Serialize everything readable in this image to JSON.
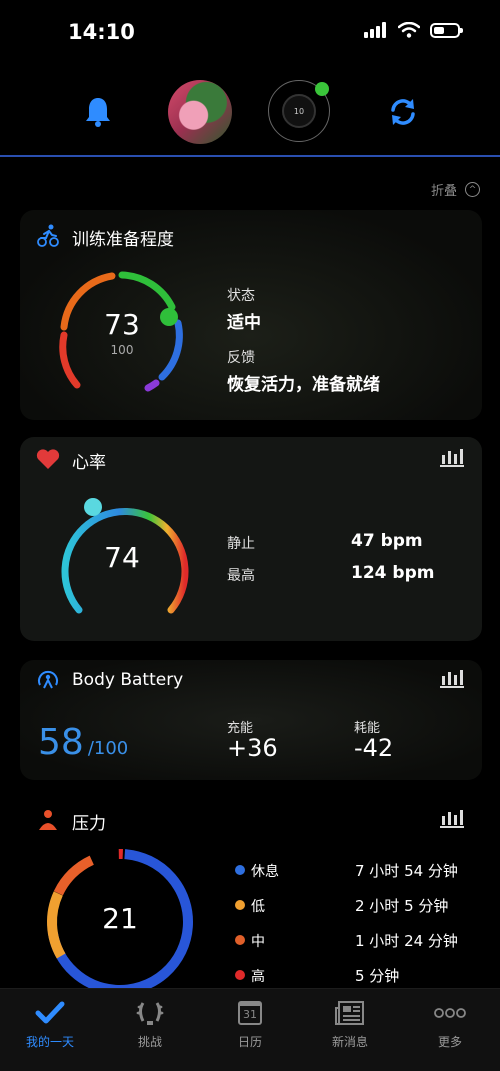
{
  "status_bar": {
    "time": "14:10"
  },
  "header": {
    "watch_face_text": "10"
  },
  "collapse_label": "折叠",
  "training_readiness": {
    "title": "训练准备程度",
    "score": "73",
    "max": "100",
    "state_label": "状态",
    "state_value": "适中",
    "feedback_label": "反馈",
    "feedback_value": "恢复活力，准备就绪"
  },
  "heart_rate": {
    "title": "心率",
    "current": "74",
    "resting_label": "静止",
    "resting_value": "47 bpm",
    "max_label": "最高",
    "max_value": "124 bpm"
  },
  "body_battery": {
    "title": "Body Battery",
    "value": "58",
    "max": "/100",
    "charged_label": "充能",
    "charged_value": "+36",
    "drained_label": "耗能",
    "drained_value": "-42"
  },
  "stress": {
    "title": "压力",
    "value": "21",
    "legend": [
      {
        "label": "休息",
        "value": "7 小时 54 分钟",
        "color": "#2e6fe0"
      },
      {
        "label": "低",
        "value": "2 小时 5 分钟",
        "color": "#f0a030"
      },
      {
        "label": "中",
        "value": "1 小时 24 分钟",
        "color": "#e0602a"
      },
      {
        "label": "高",
        "value": "5 分钟",
        "color": "#e02a2a"
      }
    ]
  },
  "tabbar": {
    "tabs": [
      {
        "label": "我的一天"
      },
      {
        "label": "挑战"
      },
      {
        "label": "日历",
        "icon_text": "31"
      },
      {
        "label": "新消息"
      },
      {
        "label": "更多"
      }
    ]
  },
  "colors": {
    "accent": "#2f8cff",
    "header_line": "#2a4fb0"
  }
}
